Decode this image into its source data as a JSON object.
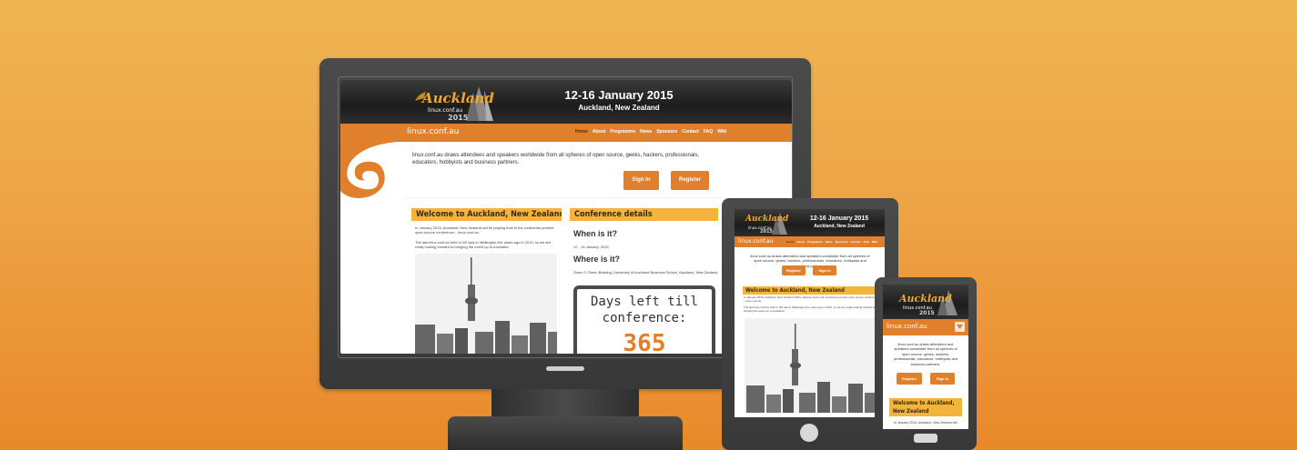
{
  "site": {
    "logo": {
      "title": "Auckland",
      "subtitle": "linux.conf.au",
      "year": "2015"
    },
    "header": {
      "dates": "12-16 January 2015",
      "location": "Auckland, New Zealand"
    },
    "brand": "linux.conf.au",
    "menu": [
      "Home",
      "About",
      "Programme",
      "News",
      "Sponsors",
      "Contact",
      "FAQ",
      "Wiki"
    ],
    "intro": "linux.conf.au draws attendees and speakers worldwide from all spheres of open source, geeks, hackers, professionals, educators, hobbyists and business partners.",
    "buttons": {
      "sign_in": "Sign In",
      "register": "Register"
    },
    "welcome": {
      "title": "Welcome to Auckland, New Zealand",
      "p1": "In January 2015, Auckland, New Zealand will be playing host to the continents premier open source conference – linux.conf.au.",
      "p2": "The last linux.conf.au held in NZ was in Wellington five years ago in 2010, so we are really looking forward to bringing the event up to Auckland.",
      "phone_p1": "In January 2015, Auckland, New Zealand will"
    },
    "conference": {
      "title": "Conference details",
      "when_heading": "When is it?",
      "when_text": "12 - 15 January, 2015.",
      "where_heading": "Where is it?",
      "where_text": "Owen G Glenn Building, University of Auckland Business School, Auckland, New Zealand.",
      "countdown_label_1": "Days left till",
      "countdown_label_2": "conference:",
      "countdown_value": "365"
    }
  },
  "colors": {
    "orange": "#e07f2c",
    "banner": "#f2b43a",
    "header_dark": "#1c1c1c",
    "device": "#404040"
  }
}
